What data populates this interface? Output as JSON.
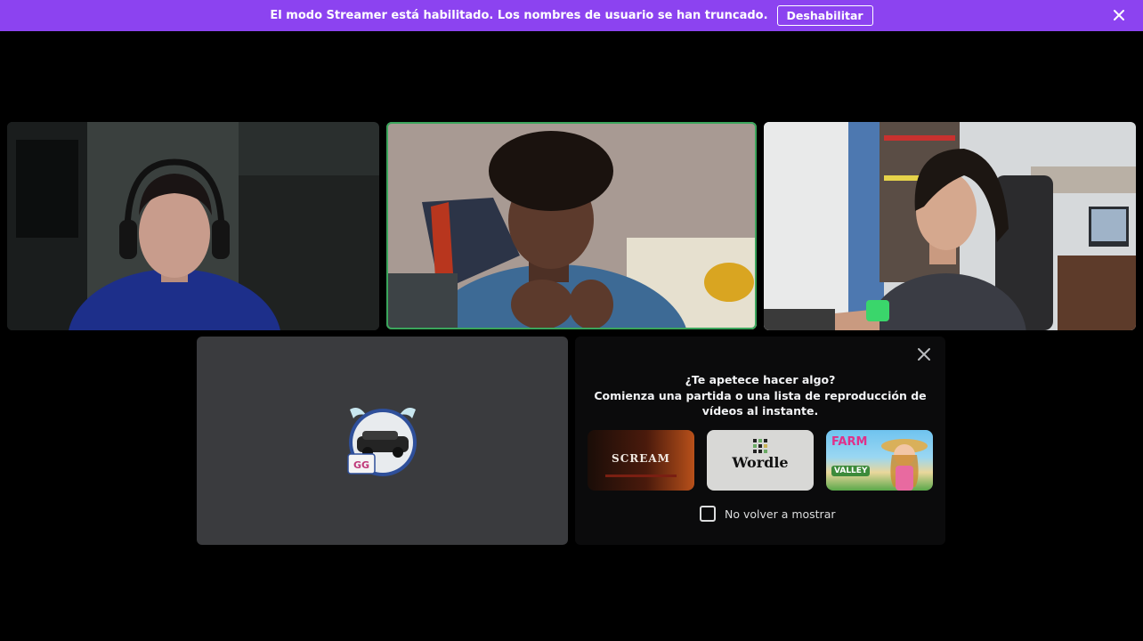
{
  "banner": {
    "message": "El modo Streamer está habilitado. Los nombres de usuario se han truncado.",
    "button_label": "Deshabilitar",
    "background": "#8c43f0",
    "close_icon": "close-icon"
  },
  "participants": [
    {
      "id": "participant-1",
      "video": "camera",
      "speaking": false,
      "shirt_color": "#1d2f8a"
    },
    {
      "id": "participant-2",
      "video": "camera",
      "speaking": true,
      "shirt_color": "#3d6a95"
    },
    {
      "id": "participant-3",
      "video": "camera",
      "speaking": false,
      "shirt_color": "#3a3c44"
    },
    {
      "id": "participant-4",
      "video": "off",
      "avatar_text": "GG"
    }
  ],
  "activity_prompt": {
    "title": "¿Te apetece hacer algo?",
    "subtitle": "Comienza una partida o una lista de reproducción de vídeos al instante.",
    "cards": [
      {
        "name": "scream",
        "label": "SCREAM"
      },
      {
        "name": "wordle",
        "label": "Wordle"
      },
      {
        "name": "farm",
        "label": "FARM",
        "sublabel": "VALLEY"
      }
    ],
    "dont_show_label": "No volver a mostrar",
    "close_icon": "close-icon"
  },
  "colors": {
    "speaking_outline": "#3ba55c",
    "tile_off_bg": "#3a3b3e",
    "panel_bg": "#0b0b0c"
  }
}
